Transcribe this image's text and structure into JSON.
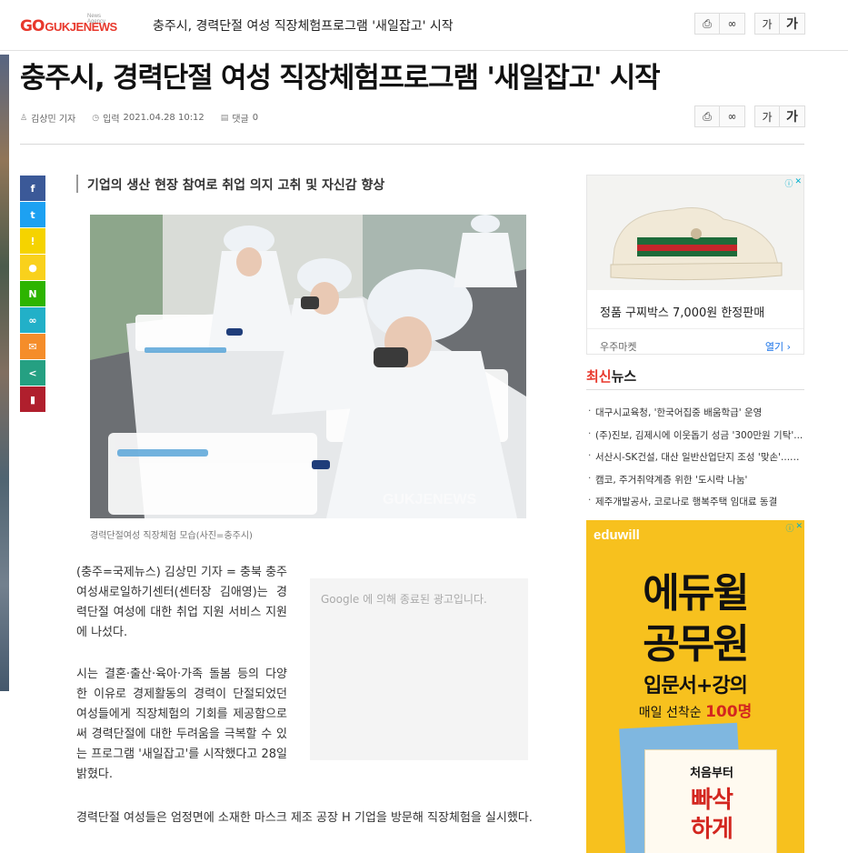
{
  "header": {
    "logo_go": "GO",
    "logo_word": "GUKJENEWS",
    "logo_sub": "News Agency",
    "short_title": "충주시, 경력단절 여성 직장체험프로그램 '새일잡고' 시작",
    "font_small": "가",
    "font_large": "가"
  },
  "article": {
    "headline": "충주시, 경력단절 여성 직장체험프로그램 '새일잡고' 시작",
    "author": "김상민 기자",
    "published_label": "입력",
    "published": "2021.04.28 10:12",
    "comments_label": "댓글",
    "comments_count": "0",
    "subtitle": "기업의 생산 현장 참여로 취업 의지 고취 및 자신감 향상",
    "photo_watermark": "GUKJENEWS",
    "caption": "경력단절여성 직장체험 모습(사진=충주시)",
    "paragraphs": [
      "(충주=국제뉴스) 김상민 기자 = 충북 충주여성새로일하기센터(센터장 김애영)는 경력단절 여성에 대한 취업 지원 서비스 지원에 나섰다.",
      "시는 결혼·출산·육아·가족 돌봄 등의 다양한 이유로 경제활동의 경력이 단절되었던 여성들에게 직장체험의 기회를 제공함으로써 경력단절에 대한 두려움을 극복할 수 있는 프로그램 '새일잡고'를 시작했다고 28일 밝혔다.",
      "경력단절 여성들은 엄정면에 소재한 마스크 제조 공장 H 기업을 방문해 직장체험을 실시했다."
    ]
  },
  "share_icons": [
    {
      "name": "facebook-icon",
      "glyph": "f",
      "color": "#3b5998"
    },
    {
      "name": "twitter-icon",
      "glyph": "t",
      "color": "#1da1f2"
    },
    {
      "name": "kakaostory-icon",
      "glyph": "!",
      "color": "#f5d300"
    },
    {
      "name": "kakaotalk-icon",
      "glyph": "●",
      "color": "#f9d11c"
    },
    {
      "name": "naver-icon",
      "glyph": "N",
      "color": "#2db400"
    },
    {
      "name": "link-icon",
      "glyph": "∞",
      "color": "#22b0c8"
    },
    {
      "name": "email-icon",
      "glyph": "✉",
      "color": "#f58d2a"
    },
    {
      "name": "share-icon",
      "glyph": "<",
      "color": "#25a082"
    },
    {
      "name": "bookmark-icon",
      "glyph": "▮",
      "color": "#b01f2d"
    }
  ],
  "ads": {
    "google_closed": "Google 에 의해 종료된 광고입니다.",
    "product_name": "정품 구찌박스 7,000원 한정판매",
    "product_seller": "우주마켓",
    "product_open": "열기",
    "edu_brand": "eduwill",
    "edu_line1": "에듀윌",
    "edu_line2": "공무원",
    "edu_line3": "입문서+강의",
    "edu_line4_prefix": "매일 선착순",
    "edu_line4_count": "100명",
    "edu_book1": "처음부터",
    "edu_book2": "빠삭",
    "edu_book3": "하게"
  },
  "latest": {
    "head_red": "최신",
    "head_rest": "뉴스",
    "items": [
      "대구시교육청, '한국어집중 배움학급' 운영",
      "(주)진보, 김제시에 이웃돕기 성금 '300만원 기탁'...",
      "서산시-SK건설, 대산 일반산업단지 조성 '맞손'...2...",
      "캠코, 주거취약계층 위한 '도시락 나눔'",
      "제주개발공사, 코로나로 행복주택 임대료 동결"
    ]
  },
  "colors": {
    "brand_red": "#e8382c",
    "edu_yellow": "#f7c11e",
    "ad_blue": "#1a73e8"
  }
}
